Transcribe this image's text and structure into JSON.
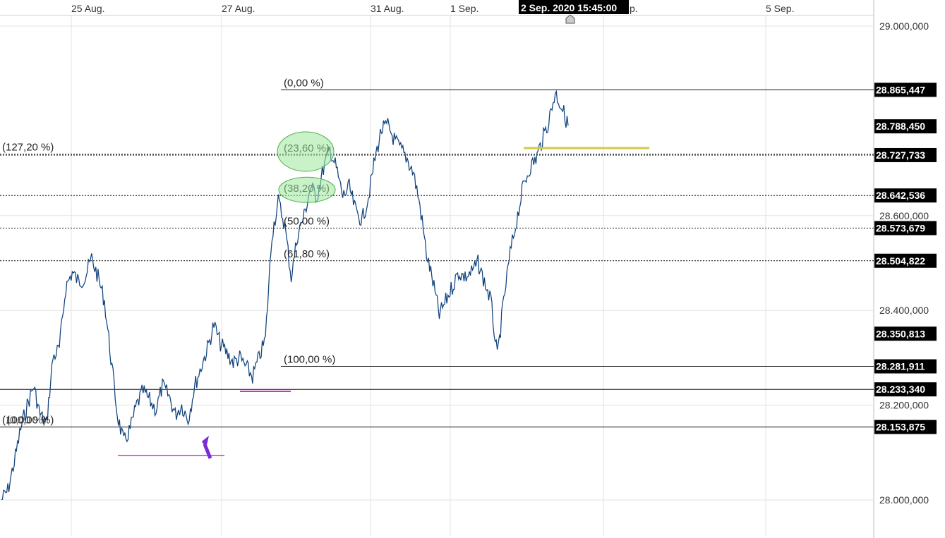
{
  "chart_data": {
    "type": "line",
    "title": "",
    "xlabel": "",
    "ylabel": "",
    "x_tick_labels": [
      "25 Aug.",
      "27 Aug.",
      "31 Aug.",
      "1 Sep.",
      "5 Sep."
    ],
    "y_tick_labels": [
      "29.000,000",
      "28.600,000",
      "28.400,000",
      "28.200,000",
      "28.000,000"
    ],
    "y_tick_values": [
      29000000,
      28600000,
      28400000,
      28200000,
      28000000
    ],
    "ylim": [
      27940000,
      29060000
    ],
    "grid": true,
    "cursor_label": "2 Sep. 2020 15:45:00",
    "hidden_tick_fragment": "p.",
    "current_price": {
      "label": "28.788,450",
      "value": 28788450
    },
    "last_marker": {
      "label": "28.350,813",
      "value": 28350813
    },
    "price_lines": [
      {
        "label": "28.865,447",
        "value": 28865447
      },
      {
        "label": "28.727,733",
        "value": 28727733
      },
      {
        "label": "28.642,536",
        "value": 28642536
      },
      {
        "label": "28.573,679",
        "value": 28573679
      },
      {
        "label": "28.504,822",
        "value": 28504822
      },
      {
        "label": "28.281,911",
        "value": 28281911
      },
      {
        "label": "28.233,340",
        "value": 28233340
      },
      {
        "label": "28.153,875",
        "value": 28153875
      }
    ],
    "fib_levels": [
      {
        "label": "(0,00 %)",
        "value": 28865447
      },
      {
        "label": "(23,60 %)",
        "value": 28727733
      },
      {
        "label": "(38,20 %)",
        "value": 28642536
      },
      {
        "label": "(50,00 %)",
        "value": 28573679
      },
      {
        "label": "(61,80 %)",
        "value": 28504822
      },
      {
        "label": "(100,00 %)",
        "value": 28281911
      }
    ],
    "ext_levels": [
      {
        "label": "(127,20 %)",
        "value": 28730000
      },
      {
        "label": "(100,00 %)",
        "value": 28153875
      },
      {
        "label": "(0,00 %)",
        "value": 28153875
      }
    ],
    "series": [
      {
        "values": [
          28000000,
          28020000,
          28080000,
          28150000,
          28200000,
          28240000,
          28180000,
          28160000,
          28300000,
          28320000,
          28450000,
          28480000,
          28460000,
          28470000,
          28510000,
          28470000,
          28420000,
          28300000,
          28180000,
          28120000,
          28150000,
          28200000,
          28230000,
          28210000,
          28190000,
          28240000,
          28220000,
          28180000,
          28200000,
          28170000,
          28240000,
          28280000,
          28320000,
          28370000,
          28330000,
          28310000,
          28290000,
          28300000,
          28280000,
          28260000,
          28300000,
          28340000,
          28560000,
          28630000,
          28580000,
          28470000,
          28560000,
          28600000,
          28660000,
          28640000,
          28700000,
          28740000,
          28700000,
          28640000,
          28660000,
          28610000,
          28590000,
          28640000,
          28720000,
          28780000,
          28790000,
          28760000,
          28740000,
          28720000,
          28690000,
          28620000,
          28520000,
          28460000,
          28390000,
          28420000,
          28450000,
          28480000,
          28470000,
          28480000,
          28500000,
          28460000,
          28420000,
          28300000,
          28420000,
          28520000,
          28590000,
          28660000,
          28700000,
          28720000,
          28760000,
          28800000,
          28860000,
          28830000,
          28790000
        ],
        "x_start": 0,
        "x_end": 88
      }
    ]
  }
}
